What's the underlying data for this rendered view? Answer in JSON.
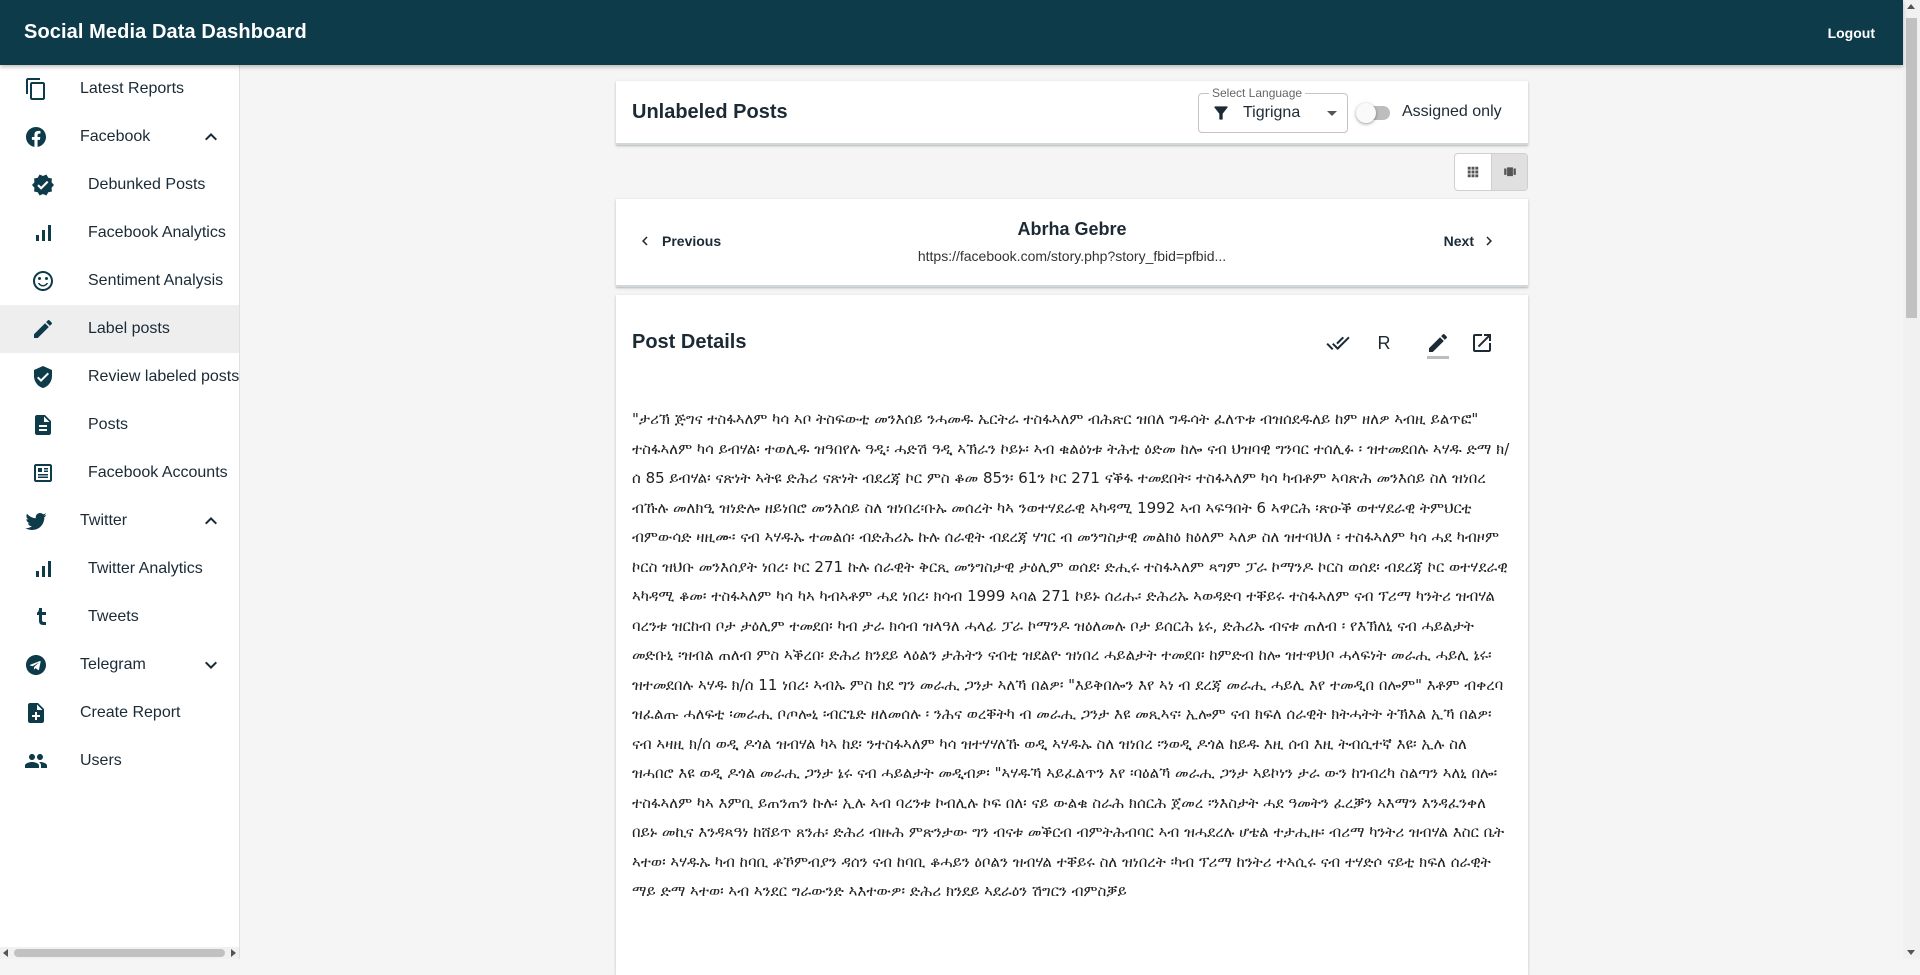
{
  "app": {
    "title": "Social Media Data Dashboard",
    "logout_label": "Logout"
  },
  "sidebar": {
    "items": [
      {
        "label": "Latest Reports",
        "icon": "reports-icon"
      },
      {
        "label": "Facebook",
        "icon": "facebook-icon",
        "expanded": true
      },
      {
        "label": "Debunked Posts",
        "icon": "verified-badge-icon"
      },
      {
        "label": "Facebook Analytics",
        "icon": "analytics-bars-icon"
      },
      {
        "label": "Sentiment Analysis",
        "icon": "smiley-face-icon"
      },
      {
        "label": "Label posts",
        "icon": "pencil-icon",
        "active": true
      },
      {
        "label": "Review labeled posts",
        "icon": "shield-check-icon"
      },
      {
        "label": "Posts",
        "icon": "document-icon"
      },
      {
        "label": "Facebook Accounts",
        "icon": "account-card-icon"
      },
      {
        "label": "Twitter",
        "icon": "twitter-icon",
        "expanded": true
      },
      {
        "label": "Twitter Analytics",
        "icon": "analytics-bars-icon"
      },
      {
        "label": "Tweets",
        "icon": "tumblr-t-icon"
      },
      {
        "label": "Telegram",
        "icon": "telegram-icon",
        "expanded": false
      },
      {
        "label": "Create Report",
        "icon": "add-document-icon"
      },
      {
        "label": "Users",
        "icon": "users-icon"
      }
    ]
  },
  "header": {
    "title": "Unlabeled Posts",
    "language_label": "Select Language",
    "language_value": "Tigrigna",
    "assigned_only_label": "Assigned only",
    "assigned_only_checked": false
  },
  "post_nav": {
    "previous_label": "Previous",
    "next_label": "Next",
    "author": "Abrha Gebre",
    "url": "https://facebook.com/story.php?story_fbid=pfbid..."
  },
  "details": {
    "title": "Post Details",
    "r_label": "R",
    "text": "\"ታሪኽ ጅግና ተስፋኣለም ካሳ ኣቦ ትስፍውቲ መንእሰይ ንሓመዱ ኤርትራ ተስፋኣለም ብሕጽር ዝበለ ግዱሳት ፈለጥቱ ብዝሰደዱለይ ከም ዘለዎ ኣብዚ ይልጥፎ\" ተስፋኣለም ካሳ ይብሃል፡ ተወሊዱ ዝዓበየሉ ዓዲ፡ ሓድሽ ዓዲ ኣኽራን ኮይኑ፡ ኣብ ቁልዕነቱ ትሕቲ ዕድመ ከሎ ናብ ህዝባዊ ግንባር ተሰሊፉ ፡ ዝተመደበሉ ኣሃዱ ድማ ክ/ሰ 85 ይብሃል፡ ናጽነት ኣትዩ ድሕሪ ናጽነት ብደረጃ ኮር ምስ ቆመ 85ን፡ 61ን ኮር 271 ናቕፋ ተመደበት፡ ተስፋኣለም ካሳ ካብቶም ኣባጽሕ መንእሰይ ስለ ዝነበረ ብኹሉ መለክዒ ዝነድሎ ዘይነበሮ መንእሰይ ስለ ዝነበረ፡ቡኡ መሰረት ካኣ ንወተሃደራዊ ኣካዳሚ 1992 ኣብ ኣፍዓበት 6 ኣዋርሕ ፡ጽዑቕ ወተሃደራዊ ትምህርቲ ብምውሳድ ዛዚሙ፡ ናብ ኣሃዱኡ ተመልሰ፡ ብድሕሪኡ ኩሉ ሰራዊት ብደረጃ ሃገር ብ መንግስታዊ መልክዕ ክዕለም ኣለዎ ስለ ዝተባህለ ፡ ተስፋኣለም ካሳ ሓደ ካብዞም ኮርስ ዝህቡ መንእሰያት ነበረ፡ ኮር 271 ኩሉ ሰራዊት ቅርጺ መንግስታዊ ታዕሊም ወሰደ፡ ድሒሩ ተስፋኣለም ጻግም ፓራ ኮማንዶ ኮርስ ወሰደ፡ ብደረጃ ኮር ወተሃደራዊ ኣካዳሚ ቆመ፡ ተስፋኣለም ካሳ ካኣ ካብኣቶም ሓደ ነበረ፡ ክሳብ 1999 ኣባል 271 ኮይኑ ሰሪሑ፡ ድሕሪኡ ኣወዳድባ ተቐይሩ ተስፋኣለም ናብ ፕሪማ ካንትሪ ዝብሃል ባረንቱ ዝርከብ ቦታ ታዕሊም ተመደበ፡ ካብ ታራ ክሳብ ዝላዓለ ሓላፊ ፓራ ኮማንዶ ዝዕለመሉ ቦታ ይሰርሕ ኔሩ, ድሕሪኡ ብናቱ ጠለብ ፡ የእኽለኒ ናብ ሓይልታት መድቡኒ ፡ዝብል ጠለብ ምስ ኣቕረበ፡ ድሕሪ ክንደይ ላዕልን ታሕትን ናብቲ ዝደልዮ ዝነበረ ሓይልታት ተመደበ፡ ከምድብ ከሎ ዝተዋህቦ ሓላፍነት መራሒ ሓይሊ ኔሩ፡ዝተመደበሉ ኣሃዱ ክ/ሰ 11 ነበረ፡ ኣብኡ ምስ ከደ ግን መራሒ ጋንታ ኣለኻ በልዎ፡ \"እይቅበሎን እየ ኣነ ብ ደረጃ መራሒ ሓይሊ እየ ተመዲበ በሎም\" እቶም ብቀረባ ዝፈልጡ ሓለፍቲ ፡መራሒ ቦጦሎኒ ፡ብርጌድ ዘለመሰሉ ፡ ንሕና ወረቐትካ ብ መራሒ ጋንታ እዩ መጺኣና፡ ኢሎም ናብ ክፍለ ሰራዊት ክትሓትት ትኽእል ኢኻ በልዎ፡ ናብ ኣዛዚ ክ/ሰ ወዲ ዶጎል ዝብሃል ካኣ ከደ፡ ንተስፋኣለም ካሳ ዝተሃሃለኹ ወዲ ኣሃዱኡ ስለ ዝነበረ ፡ንወዲ ዶጎል ከይዱ እዚ ሰብ እዚ ትብሲተኛ እዩ፡ ኢሉ ስለ ዝሓበሮ እዩ ወዲ ዶጎል መራሒ ጋንታ ኔሩ ናብ ሓይልታት መዲብዎ፡ \"ኣሃዱኻ ኣይፈልጥን እየ ፡ባዕልኻ መራሒ ጋንታ ኣይኮነን ታራ ውን ከገብረካ ስልጣን ኣለኒ በሎ፡ ተስፋኣለም ካኣ እምቢ ይጠንጠን ኩሉ፡ ኢሉ ኣብ ባረንቱ ኮብሊሉ ኮፍ በለ፡ ናይ ውልቁ ስራሕ ክሰርሕ ጀመረ ፡ንእስታት ሓደ ዓመትን ፈረቓን ኣእማን እንዳፈንቀለ በይኑ መኪና እንዳጻዓነ ከሸይጥ ጸንሐ፡ ድሕሪ ብዙሕ ምጽንታው ግን ብናቱ መቕርብ ብምትሕብባር ኣብ ዝሓደረሉ ሆቴል ተታሒዙ፡ ብሪማ ካንትሪ ዝብሃል እስር ቤት ኣተወ፡ ኣሃዱኡ ካብ ከባቢ ቶኾምብያን ዳሰን ናብ ከባቢ ቆሓይን ዕቦልን ዝብሃል ተቐይሩ ስለ ዝነበረት ፡ካብ ፕሪማ ከንትሪ ተኣሲሩ ናብ ተሃድሶ ናይቲ ክፍለ ሰራዊት ማይ ድማ ኣተወ፡ ኣብ ኣንደር ግራውንድ ኣእተውዎ፡ ድሕሪ ክንደይ ኣደራዕን ሽግርን ብምስቓይ"
  }
}
